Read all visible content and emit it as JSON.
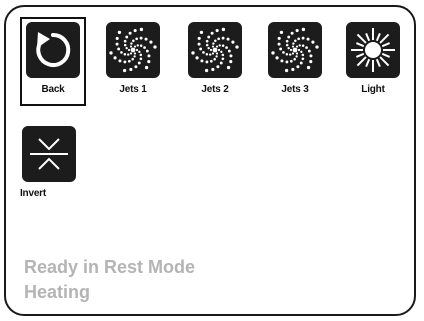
{
  "buttons": {
    "back": {
      "label": "Back",
      "icon": "back-arrow-icon"
    },
    "jets1": {
      "label": "Jets 1",
      "icon": "jets-icon"
    },
    "jets2": {
      "label": "Jets 2",
      "icon": "jets-icon"
    },
    "jets3": {
      "label": "Jets 3",
      "icon": "jets-icon"
    },
    "light": {
      "label": "Light",
      "icon": "light-sun-icon"
    },
    "invert": {
      "label": "Invert",
      "icon": "invert-icon"
    }
  },
  "status": {
    "line1": "Ready in Rest Mode",
    "line2": "Heating"
  },
  "colors": {
    "icon_background": "#1c1c1c",
    "status_text": "#b4b4b4"
  }
}
